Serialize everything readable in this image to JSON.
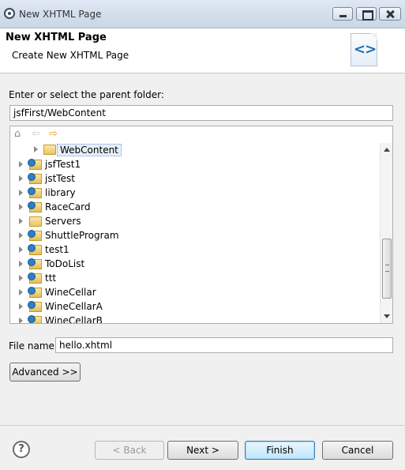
{
  "window": {
    "title": "New XHTML Page"
  },
  "banner": {
    "heading": "New XHTML Page",
    "description": "Create New XHTML Page",
    "icon": "xhtml-page-icon"
  },
  "folder": {
    "label": "Enter or select the parent folder:",
    "value": "jsfFirst/WebContent"
  },
  "tree": {
    "items": [
      {
        "name": "WebContent",
        "type": "folder",
        "selected": true,
        "level": 1
      },
      {
        "name": "jsfTest1",
        "type": "project",
        "level": 0
      },
      {
        "name": "jstTest",
        "type": "project",
        "level": 0
      },
      {
        "name": "library",
        "type": "project",
        "level": 0
      },
      {
        "name": "RaceCard",
        "type": "project",
        "level": 0
      },
      {
        "name": "Servers",
        "type": "folder",
        "level": 0
      },
      {
        "name": "ShuttleProgram",
        "type": "project",
        "level": 0
      },
      {
        "name": "test1",
        "type": "project",
        "level": 0
      },
      {
        "name": "ToDoList",
        "type": "project",
        "level": 0
      },
      {
        "name": "ttt",
        "type": "project",
        "level": 0
      },
      {
        "name": "WineCellar",
        "type": "project",
        "level": 0
      },
      {
        "name": "WineCellarA",
        "type": "project",
        "level": 0
      },
      {
        "name": "WineCellarB",
        "type": "project",
        "level": 0
      }
    ]
  },
  "file": {
    "label": "File name:",
    "value": "hello.xhtml"
  },
  "buttons": {
    "advanced": "Advanced >>",
    "back": "< Back",
    "next": "Next >",
    "finish": "Finish",
    "cancel": "Cancel",
    "help": "?"
  }
}
